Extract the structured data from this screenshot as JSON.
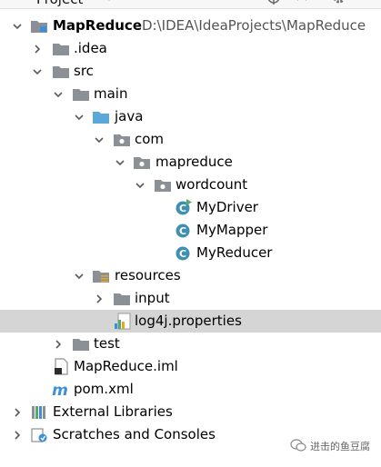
{
  "header": {
    "title": "Project"
  },
  "tree": {
    "root": {
      "name": "MapReduce",
      "path": "D:\\IDEA\\IdeaProjects\\MapReduce"
    },
    "idea": ".idea",
    "src": "src",
    "main": "main",
    "java": "java",
    "com": "com",
    "mapreduce": "mapreduce",
    "wordcount": "wordcount",
    "classes": [
      "MyDriver",
      "MyMapper",
      "MyReducer"
    ],
    "resources": "resources",
    "input": "input",
    "log4j": "log4j.properties",
    "test": "test",
    "iml": "MapReduce.iml",
    "pom": "pom.xml",
    "ext_libs": "External Libraries",
    "scratches": "Scratches and Consoles"
  },
  "watermark": "进击的鱼豆腐",
  "colors": {
    "selected_row": "#d5d5d5",
    "folder": "#8b9096",
    "source_folder": "#59a8d8",
    "class_icon": "#3e8fb0"
  }
}
